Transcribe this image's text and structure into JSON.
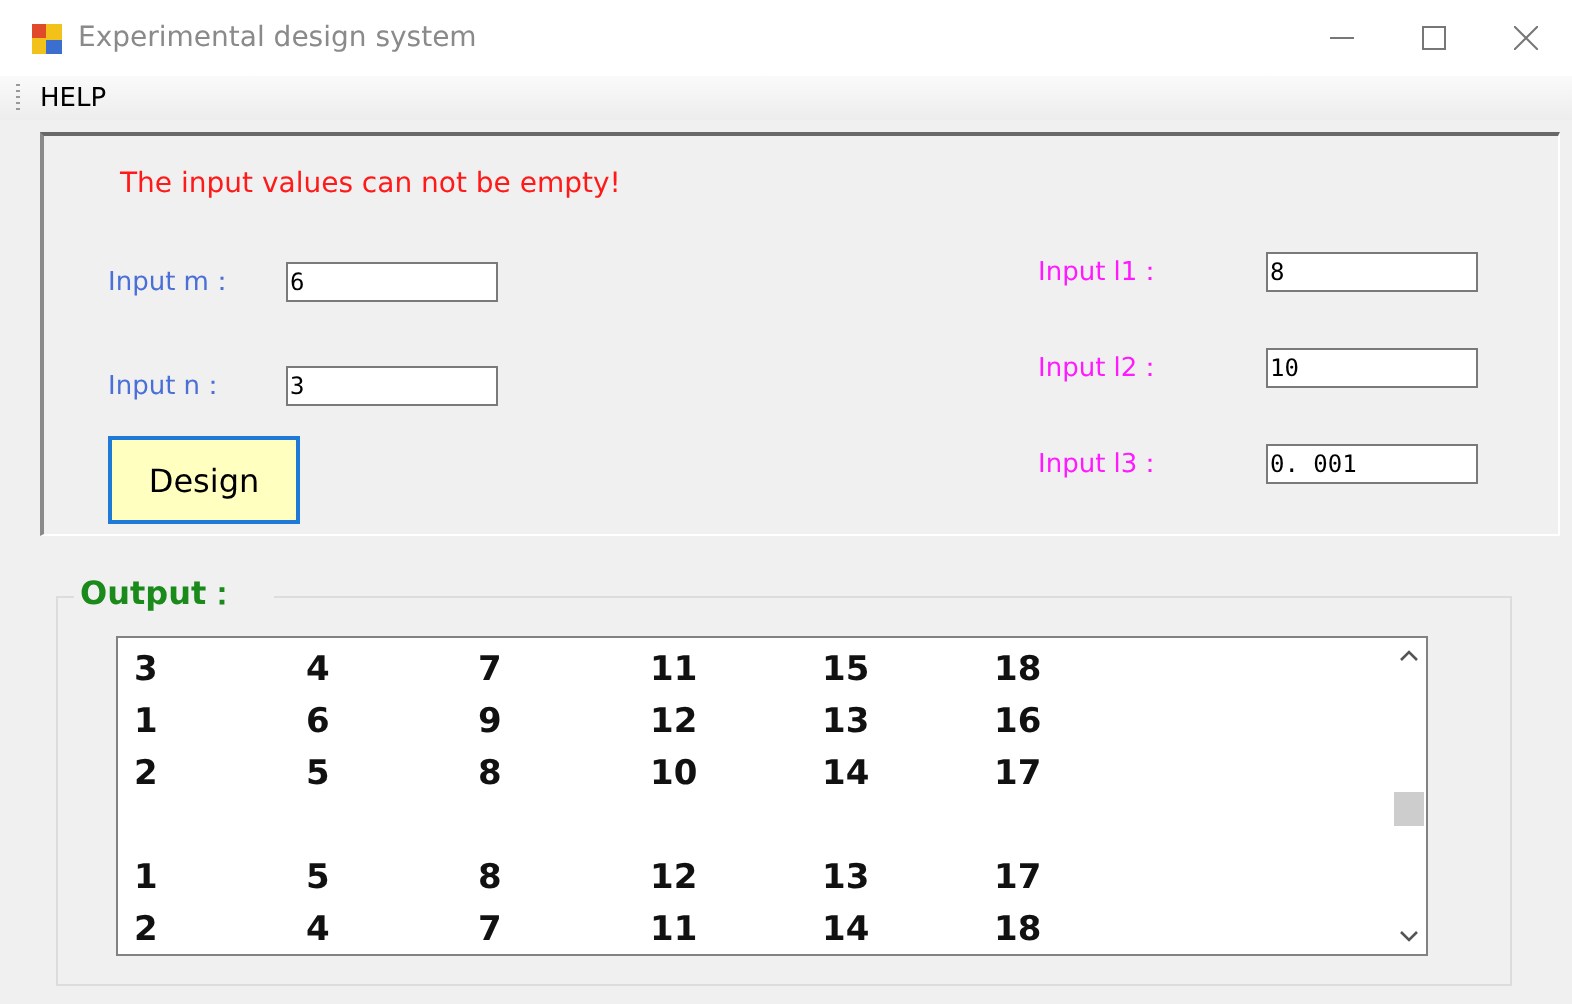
{
  "window": {
    "title": "Experimental design system"
  },
  "menu": [
    {
      "label": "HELP"
    }
  ],
  "message": "The input values can not be empty!",
  "left_fields": [
    {
      "label": "Input m：",
      "value": "6"
    },
    {
      "label": "Input n：",
      "value": "3"
    }
  ],
  "right_fields": [
    {
      "label": "Input l1：",
      "value": "8"
    },
    {
      "label": "Input l2：",
      "value": "10"
    },
    {
      "label": "Input l3：",
      "value": "0. 001"
    }
  ],
  "design_button": "Design",
  "output": {
    "title": "Output：",
    "blocks": [
      [
        [
          "3",
          "4",
          "7",
          "11",
          "15",
          "18"
        ],
        [
          "1",
          "6",
          "9",
          "12",
          "13",
          "16"
        ],
        [
          "2",
          "5",
          "8",
          "10",
          "14",
          "17"
        ]
      ],
      [
        [
          "1",
          "5",
          "8",
          "12",
          "13",
          "17"
        ],
        [
          "2",
          "4",
          "7",
          "11",
          "14",
          "18"
        ]
      ]
    ]
  }
}
